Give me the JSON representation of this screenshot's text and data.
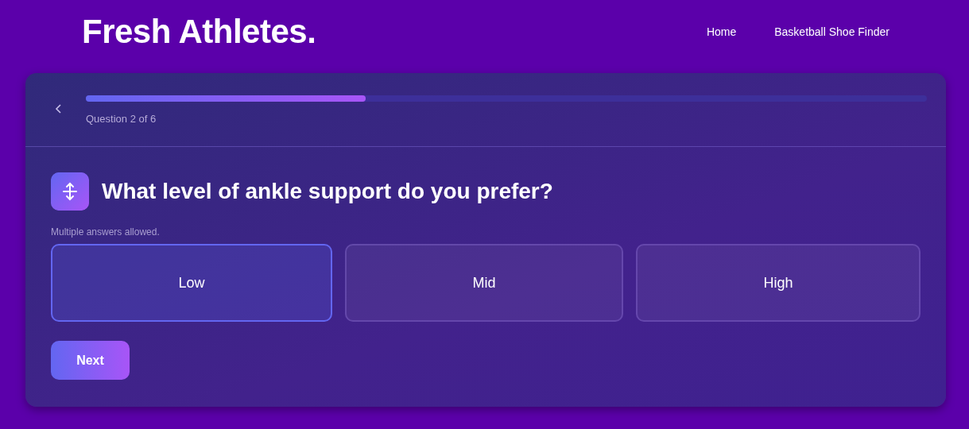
{
  "brand": "Fresh Athletes.",
  "nav": [
    {
      "label": "Home"
    },
    {
      "label": "Basketball Shoe Finder"
    }
  ],
  "progress": {
    "level": 0.333,
    "caption": "Question 2 of 6"
  },
  "question": {
    "title": "What level of ankle support do you prefer?",
    "hint": "Multiple answers allowed."
  },
  "options": [
    {
      "label": "Low",
      "selected": true
    },
    {
      "label": "Mid",
      "selected": false
    },
    {
      "label": "High",
      "selected": false
    }
  ],
  "next_button": "Next"
}
